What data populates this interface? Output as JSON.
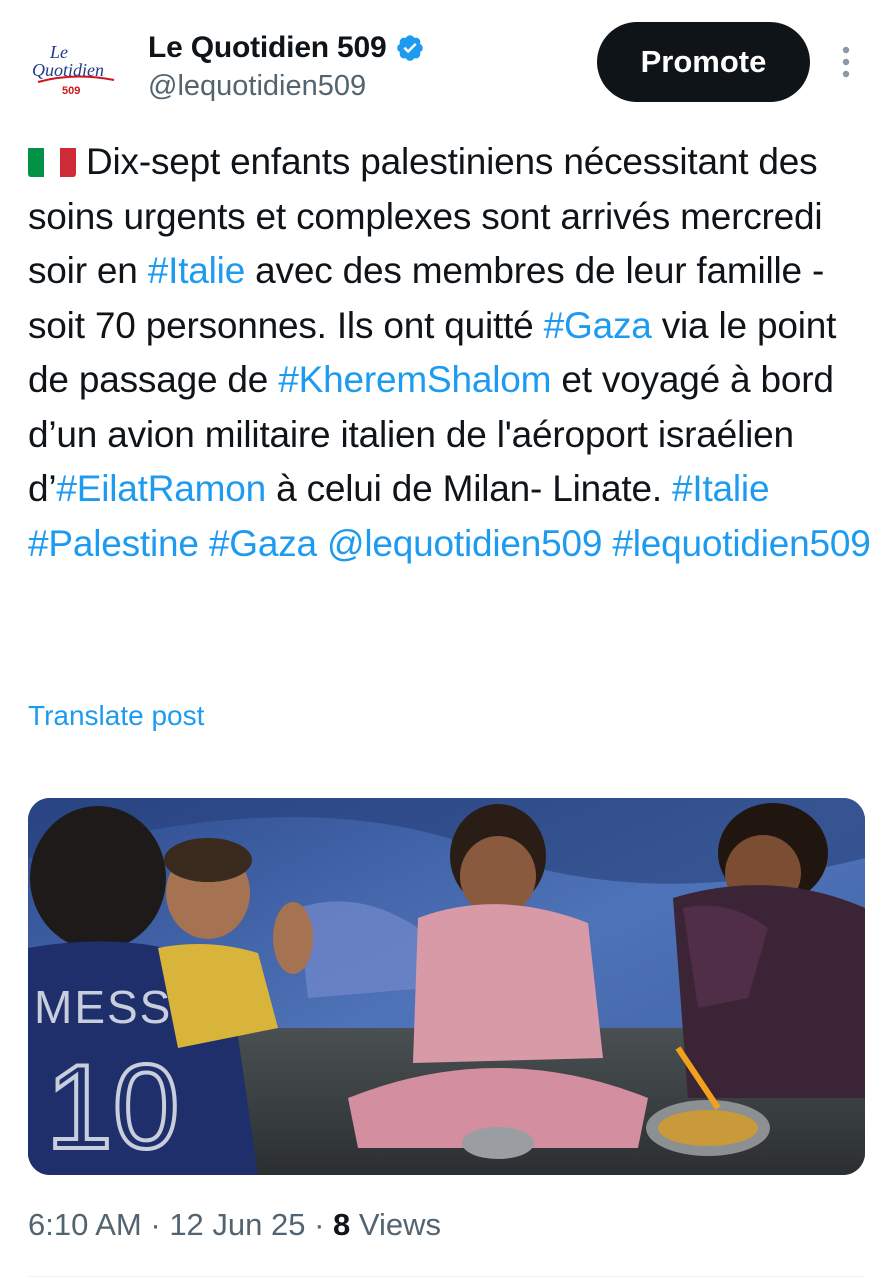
{
  "author": {
    "display_name": "Le Quotidien 509",
    "handle": "@lequotidien509",
    "verified": true,
    "avatar_logo": {
      "line1": "Le",
      "line2": "Quotidien",
      "line3": "509"
    }
  },
  "header": {
    "promote_label": "Promote",
    "more_icon": "more-vertical-icon"
  },
  "tweet": {
    "flag_icon": "italy-flag-icon",
    "segments": [
      {
        "text": "Dix-sept enfants palestiniens nécessitant des soins urgents et complexes sont arrivés mercredi soir en "
      },
      {
        "text": "#Italie",
        "link": true
      },
      {
        "text": " avec des membres de leur famille - soit 70 personnes. Ils ont quitté "
      },
      {
        "text": "#Gaza",
        "link": true
      },
      {
        "text": " via le point de passage de "
      },
      {
        "text": "#KheremShalom",
        "link": true
      },
      {
        "text": " et voyagé à bord d’un avion militaire italien de l'aéroport israélien d’"
      },
      {
        "text": "#EilatRamon",
        "link": true
      },
      {
        "text": " à celui de Milan- Linate. "
      },
      {
        "text": "#Italie",
        "link": true
      },
      {
        "text": " "
      },
      {
        "text": "#Palestine",
        "link": true
      },
      {
        "text": " "
      },
      {
        "text": "#Gaza",
        "link": true
      },
      {
        "text": " "
      },
      {
        "text": "@lequotidien509",
        "link": true
      },
      {
        "text": " "
      },
      {
        "text": "#lequotidien509",
        "link": true
      }
    ]
  },
  "translate_label": "Translate post",
  "media": {
    "jersey_name": "MESSI",
    "jersey_number": "10"
  },
  "meta": {
    "time": "6:10 AM",
    "separator": " · ",
    "date": "12 Jun 25",
    "views_count": "8",
    "views_label": " Views"
  },
  "colors": {
    "link": "#1d9bf0",
    "text": "#0f1419",
    "secondary": "#536471",
    "verified": "#1d9bf0"
  }
}
